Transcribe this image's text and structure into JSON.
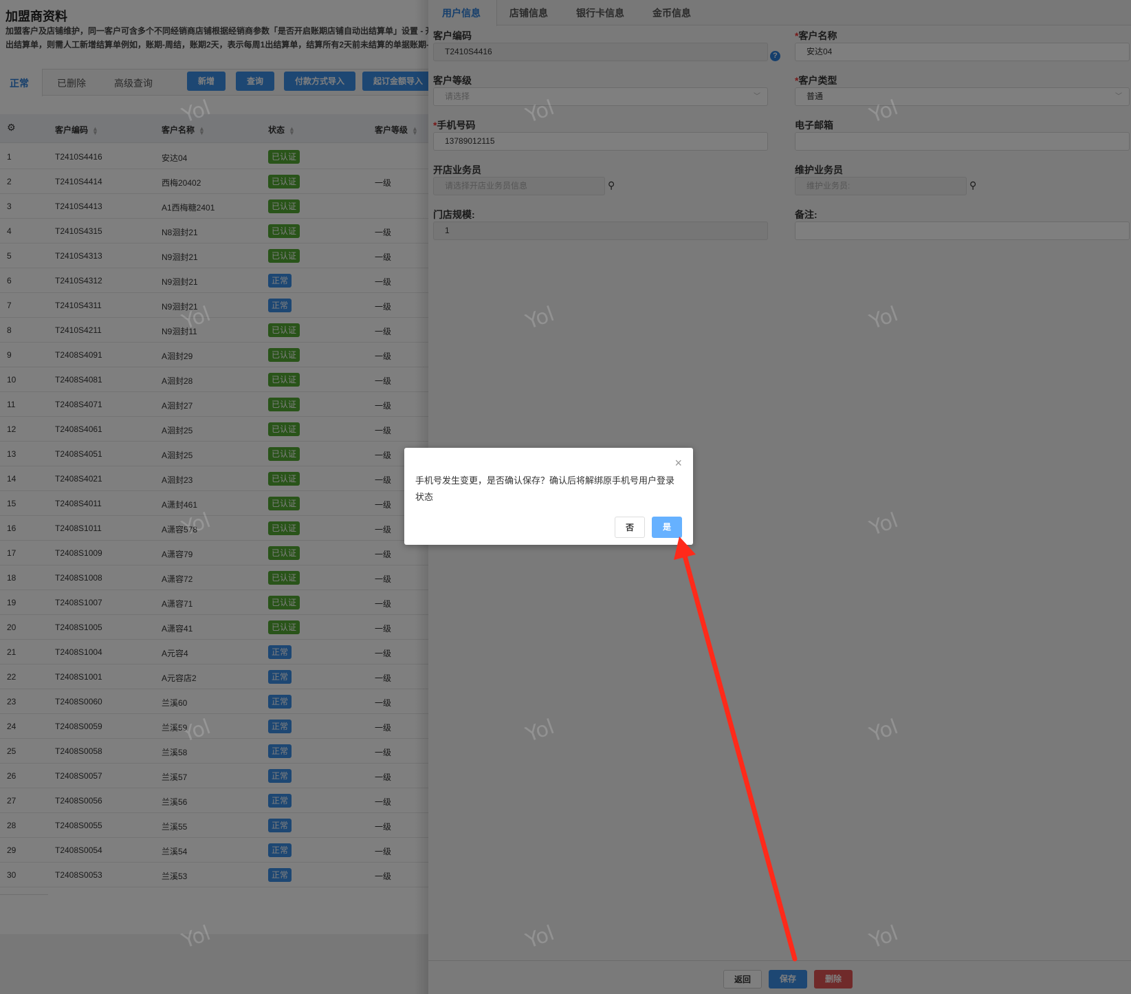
{
  "page": {
    "title": "加盟商资料",
    "desc_line1": "加盟客户及店铺维护，同一客户可含多个不同经销商店铺根据经销商参数「是否开启账期店铺自动出结算单」设置 - 开",
    "desc_line2": "出结算单，则需人工新增结算单例如，账期-周结，账期2天，表示每周1出结算单，结算所有2天前未结算的单据账期-"
  },
  "list_tabs": [
    "正常",
    "已删除",
    "高级查询"
  ],
  "toolbar": {
    "add": "新增",
    "query": "查询",
    "payment_import": "付款方式导入",
    "min_amount_import": "起订金额导入"
  },
  "table": {
    "headers": {
      "code": "客户编码",
      "name": "客户名称",
      "status": "状态",
      "level": "客户等级"
    },
    "rows": [
      [
        "1",
        "T2410S4416",
        "安达04",
        "已认证",
        ""
      ],
      [
        "2",
        "T2410S4414",
        "西梅20402",
        "已认证",
        "一级"
      ],
      [
        "3",
        "T2410S4413",
        "A1西梅糖2401",
        "已认证",
        ""
      ],
      [
        "4",
        "T2410S4315",
        "N8洄封21",
        "已认证",
        "一级"
      ],
      [
        "5",
        "T2410S4313",
        "N9洄封21",
        "已认证",
        "一级"
      ],
      [
        "6",
        "T2410S4312",
        "N9洄封21",
        "正常",
        "一级"
      ],
      [
        "7",
        "T2410S4311",
        "N9洄封21",
        "正常",
        "一级"
      ],
      [
        "8",
        "T2410S4211",
        "N9洄封11",
        "已认证",
        "一级"
      ],
      [
        "9",
        "T2408S4091",
        "A洄封29",
        "已认证",
        "一级"
      ],
      [
        "10",
        "T2408S4081",
        "A洄封28",
        "已认证",
        "一级"
      ],
      [
        "11",
        "T2408S4071",
        "A洄封27",
        "已认证",
        "一级"
      ],
      [
        "12",
        "T2408S4061",
        "A洄封25",
        "已认证",
        "一级"
      ],
      [
        "13",
        "T2408S4051",
        "A洄封25",
        "已认证",
        "一级"
      ],
      [
        "14",
        "T2408S4021",
        "A洄封23",
        "已认证",
        "一级"
      ],
      [
        "15",
        "T2408S4011",
        "A潇封461",
        "已认证",
        "一级"
      ],
      [
        "16",
        "T2408S1011",
        "A潇容578",
        "已认证",
        "一级"
      ],
      [
        "17",
        "T2408S1009",
        "A潇容79",
        "已认证",
        "一级"
      ],
      [
        "18",
        "T2408S1008",
        "A潇容72",
        "已认证",
        "一级"
      ],
      [
        "19",
        "T2408S1007",
        "A潇容71",
        "已认证",
        "一级"
      ],
      [
        "20",
        "T2408S1005",
        "A潇容41",
        "已认证",
        "一级"
      ],
      [
        "21",
        "T2408S1004",
        "A元容4",
        "正常",
        "一级"
      ],
      [
        "22",
        "T2408S1001",
        "A元容店2",
        "正常",
        "一级"
      ],
      [
        "23",
        "T2408S0060",
        "兰溪60",
        "正常",
        "一级"
      ],
      [
        "24",
        "T2408S0059",
        "兰溪59",
        "正常",
        "一级"
      ],
      [
        "25",
        "T2408S0058",
        "兰溪58",
        "正常",
        "一级"
      ],
      [
        "26",
        "T2408S0057",
        "兰溪57",
        "正常",
        "一级"
      ],
      [
        "27",
        "T2408S0056",
        "兰溪56",
        "正常",
        "一级"
      ],
      [
        "28",
        "T2408S0055",
        "兰溪55",
        "正常",
        "一级"
      ],
      [
        "29",
        "T2408S0054",
        "兰溪54",
        "正常",
        "一级"
      ],
      [
        "30",
        "T2408S0053",
        "兰溪53",
        "正常",
        "一级"
      ]
    ]
  },
  "status_colors": {
    "已认证": "#52a832",
    "正常": "#3a8ee6"
  },
  "detail": {
    "tabs": [
      "用户信息",
      "店铺信息",
      "银行卡信息",
      "金币信息"
    ],
    "fields": {
      "code": {
        "label": "客户编码",
        "value": "T2410S4416"
      },
      "name": {
        "label": "客户名称",
        "value": "安达04"
      },
      "level": {
        "label": "客户等级",
        "placeholder": "请选择"
      },
      "type": {
        "label": "客户类型",
        "value": "普通"
      },
      "phone": {
        "label": "手机号码",
        "value": "13789012115"
      },
      "email": {
        "label": "电子邮箱",
        "value": ""
      },
      "open_sales": {
        "label": "开店业务员",
        "placeholder": "请选择开店业务员信息"
      },
      "maint_sales": {
        "label": "维护业务员",
        "placeholder": "维护业务员:"
      },
      "store_size": {
        "label": "门店规模:",
        "value": "1"
      },
      "remark": {
        "label": "备注:",
        "value": ""
      }
    },
    "required_mark": "*",
    "help": "?",
    "footer": {
      "back": "返回",
      "save": "保存",
      "delete": "删除"
    }
  },
  "modal": {
    "message": "手机号发生变更，是否确认保存？确认后将解绑原手机号用户登录状态",
    "no": "否",
    "yes": "是",
    "close": "×"
  },
  "watermark": "Yol",
  "colors": {
    "primary": "#3a8ee6",
    "success": "#52a832",
    "danger": "#d9534f",
    "arrow": "#ff2a1a"
  }
}
